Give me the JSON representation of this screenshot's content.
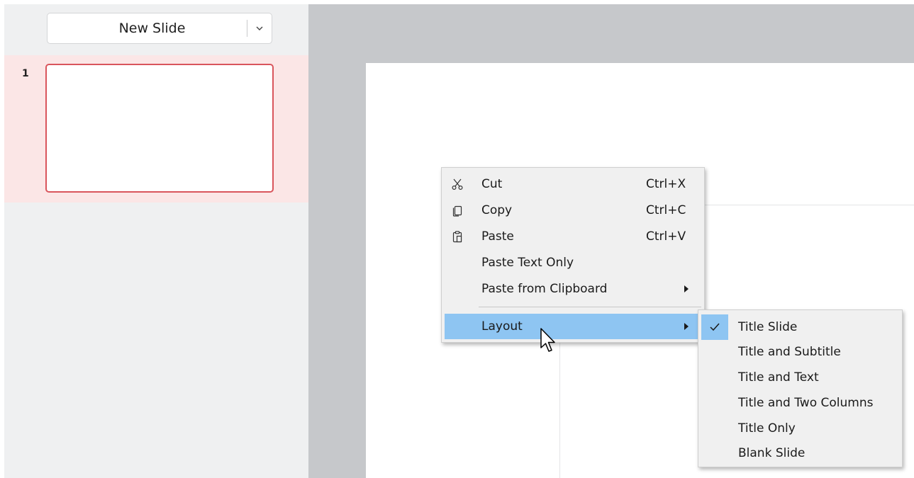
{
  "slide_panel": {
    "new_slide_label": "New Slide",
    "slides": [
      {
        "number": "1",
        "selected": true
      }
    ]
  },
  "context_menu": {
    "items": [
      {
        "label": "Cut",
        "shortcut": "Ctrl+X",
        "icon": "scissors-icon"
      },
      {
        "label": "Copy",
        "shortcut": "Ctrl+C",
        "icon": "copy-icon"
      },
      {
        "label": "Paste",
        "shortcut": "Ctrl+V",
        "icon": "paste-icon"
      },
      {
        "label": "Paste Text Only"
      },
      {
        "label": "Paste from Clipboard",
        "has_submenu": true
      },
      {
        "label": "Layout",
        "has_submenu": true,
        "highlighted": true
      }
    ]
  },
  "layout_submenu": {
    "items": [
      {
        "label": "Title Slide",
        "checked": true
      },
      {
        "label": "Title and Subtitle"
      },
      {
        "label": "Title and Text"
      },
      {
        "label": "Title and Two Columns"
      },
      {
        "label": "Title Only"
      },
      {
        "label": "Blank Slide"
      }
    ]
  },
  "colors": {
    "panel_bg": "#eff0f1",
    "selected_row_bg": "#fbe6e6",
    "selected_border": "#d9555c",
    "editor_bg": "#c6c8cb",
    "menu_bg": "#f0f0f0",
    "highlight": "#8ec5f2"
  }
}
